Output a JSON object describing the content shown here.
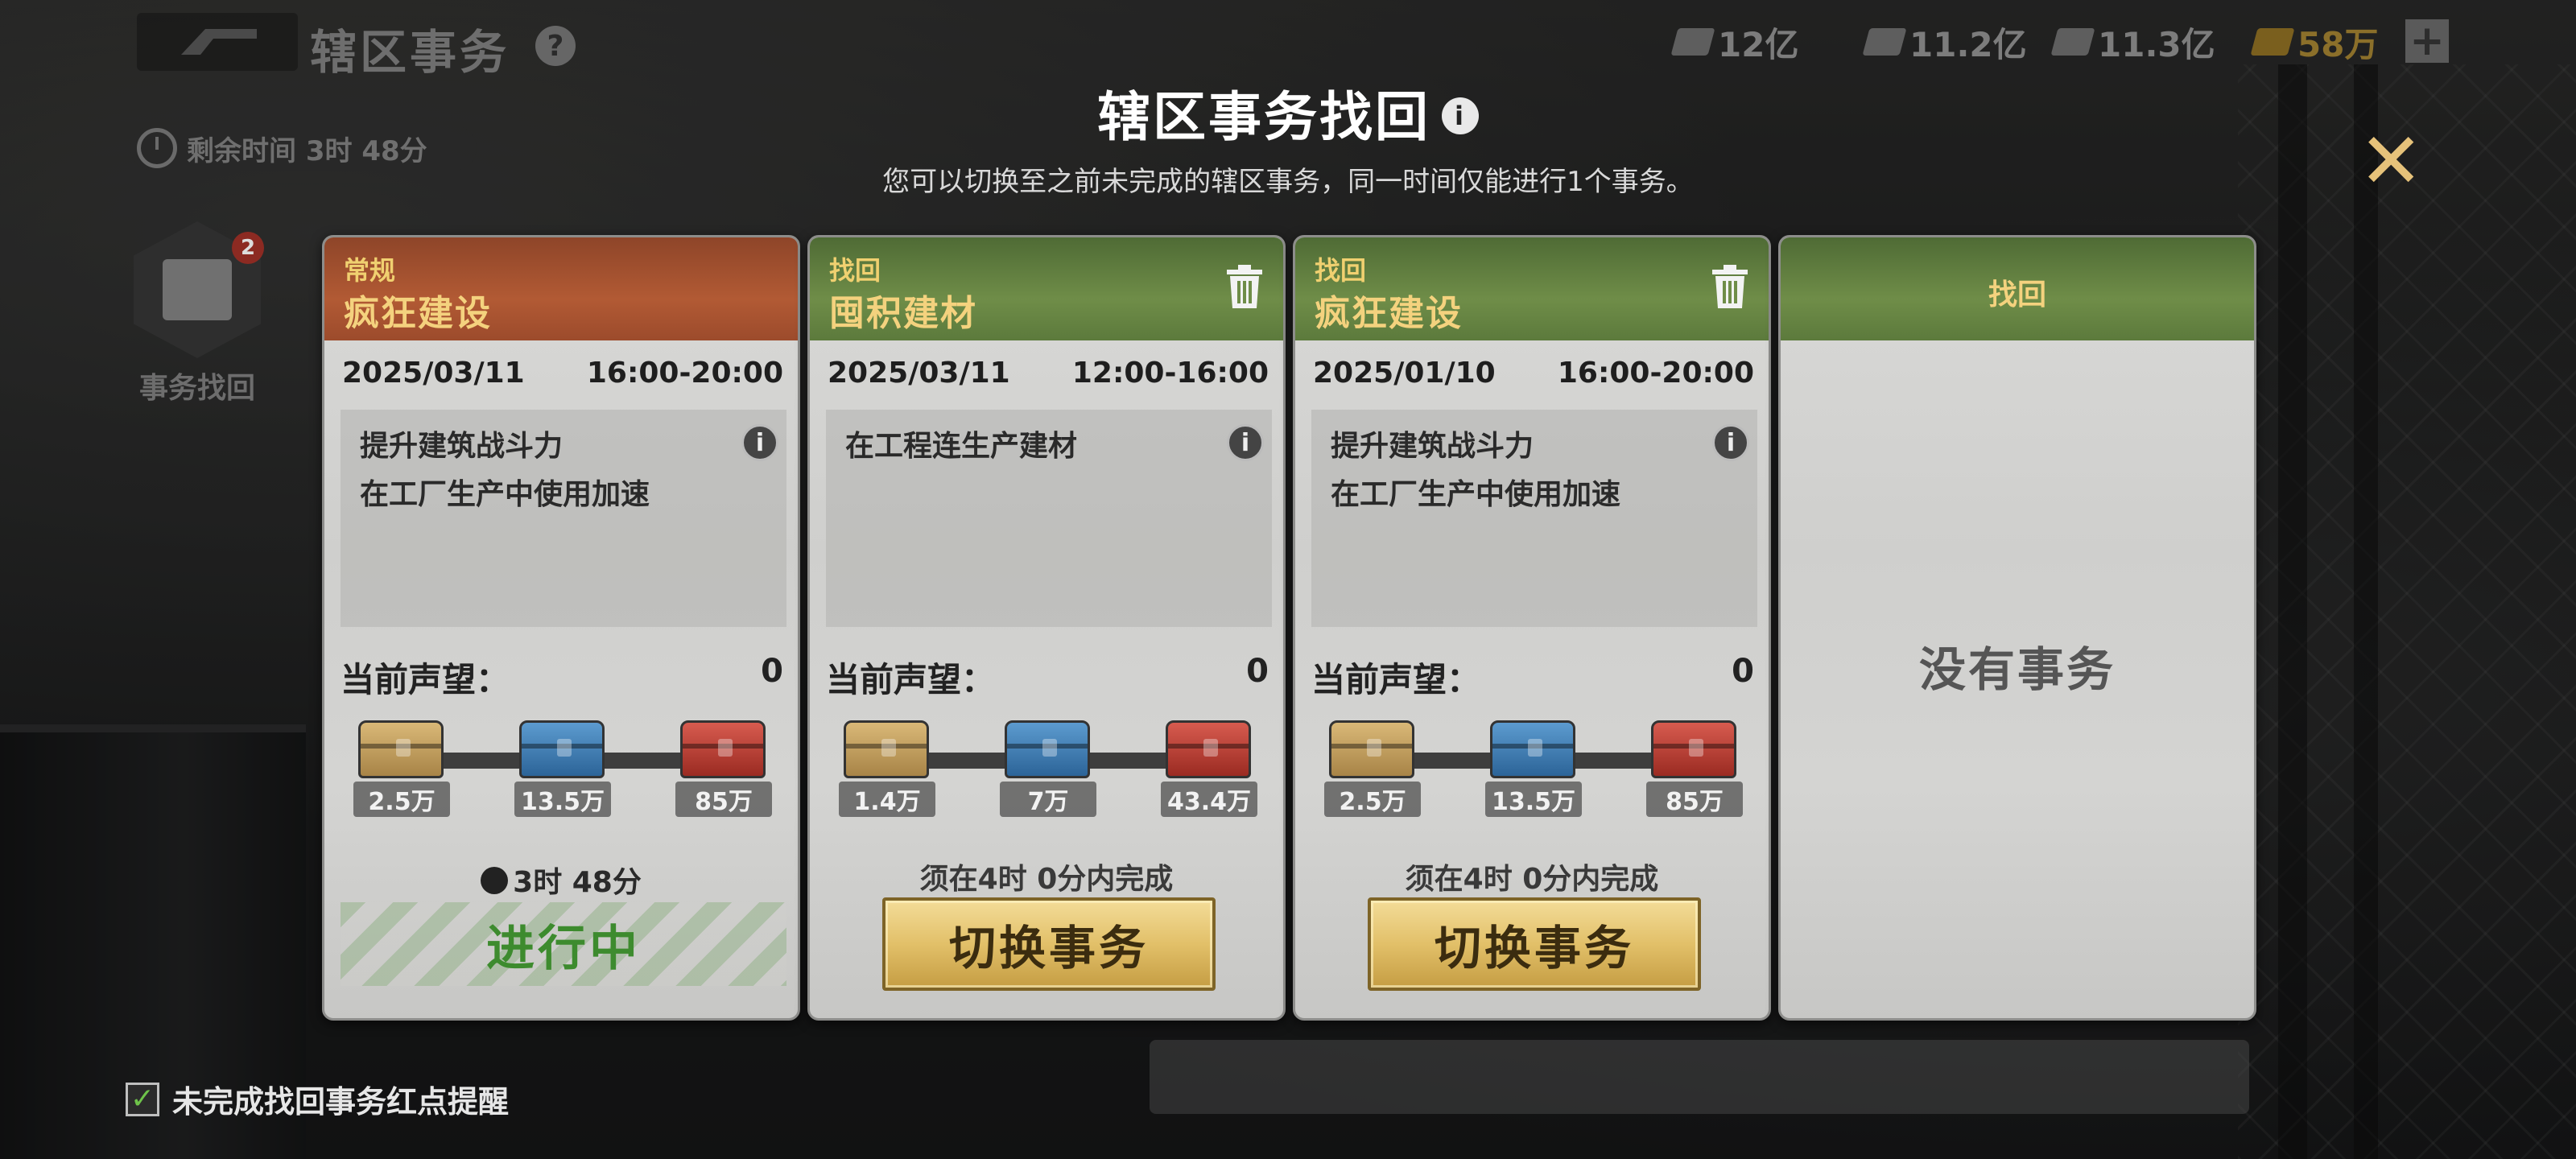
{
  "header": {
    "page_title": "辖区事务",
    "resources": [
      {
        "name": "cash",
        "value": "12亿"
      },
      {
        "name": "materials",
        "value": "11.2亿"
      },
      {
        "name": "ammo",
        "value": "11.3亿"
      },
      {
        "name": "gold",
        "value": "58万"
      }
    ]
  },
  "side": {
    "remaining_time": "剩余时间 3时 48分",
    "recover_label": "事务找回",
    "recover_badge": "2"
  },
  "modal": {
    "title": "辖区事务找回",
    "subtitle": "您可以切换至之前未完成的辖区事务，同一时间仅能进行1个事务。"
  },
  "cards": [
    {
      "type": "常规",
      "name": "疯狂建设",
      "date": "2025/03/11",
      "time": "16:00-20:00",
      "desc": [
        "提升建筑战斗力",
        "在工厂生产中使用加速"
      ],
      "rep_label": "当前声望：",
      "rep_value": "0",
      "rewards": [
        "2.5万",
        "13.5万",
        "85万"
      ],
      "countdown": "3时 48分",
      "status": "进行中"
    },
    {
      "type": "找回",
      "name": "囤积建材",
      "date": "2025/03/11",
      "time": "12:00-16:00",
      "desc": [
        "在工程连生产建材"
      ],
      "rep_label": "当前声望：",
      "rep_value": "0",
      "rewards": [
        "1.4万",
        "7万",
        "43.4万"
      ],
      "must": "须在4时 0分内完成",
      "button": "切换事务"
    },
    {
      "type": "找回",
      "name": "疯狂建设",
      "date": "2025/01/10",
      "time": "16:00-20:00",
      "desc": [
        "提升建筑战斗力",
        "在工厂生产中使用加速"
      ],
      "rep_label": "当前声望：",
      "rep_value": "0",
      "rewards": [
        "2.5万",
        "13.5万",
        "85万"
      ],
      "must": "须在4时 0分内完成",
      "button": "切换事务"
    },
    {
      "type": "找回",
      "empty_text": "没有事务"
    }
  ],
  "footer": {
    "reminder_label": "未完成找回事务红点提醒",
    "reminder_checked": true
  },
  "icons": {
    "info": "i",
    "help": "?",
    "close": "✕",
    "check": "✓",
    "plus": "+"
  },
  "colors": {
    "normal_header": "#b25a34",
    "recover_header": "#6f8d48",
    "title_gold": "#f4d27e",
    "status_green": "#3d8b2e",
    "button_gold": "#e2c069"
  }
}
